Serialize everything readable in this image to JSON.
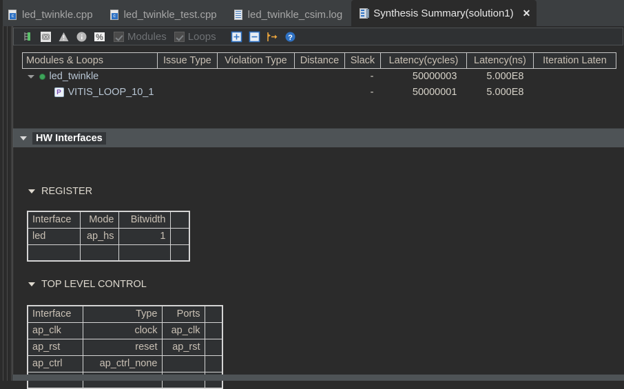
{
  "tabs": [
    {
      "label": "led_twinkle.cpp",
      "icon": "cpp-file-icon",
      "active": false,
      "closable": false
    },
    {
      "label": "led_twinkle_test.cpp",
      "icon": "cpp-file-icon",
      "active": false,
      "closable": false
    },
    {
      "label": "led_twinkle_csim.log",
      "icon": "log-file-icon",
      "active": false,
      "closable": false
    },
    {
      "label": "Synthesis Summary(solution1)",
      "icon": "report-icon",
      "active": true,
      "closable": true
    }
  ],
  "tab_close_glyph": "✕",
  "toolbar": {
    "buttons": [
      {
        "name": "tree-expand-icon",
        "title": "Expand Tree"
      },
      {
        "name": "link-icon",
        "title": "Link"
      },
      {
        "name": "warning-icon",
        "title": "Warnings"
      },
      {
        "name": "info-icon",
        "title": "Information"
      },
      {
        "name": "percent-icon",
        "title": "Percent",
        "glyph": "%"
      },
      {
        "name": "expand-all-icon",
        "title": "Expand All",
        "glyph": "+"
      },
      {
        "name": "collapse-all-icon",
        "title": "Collapse All",
        "glyph": "−"
      },
      {
        "name": "goto-icon",
        "title": "Go To"
      },
      {
        "name": "help-icon",
        "title": "Help",
        "glyph": "?"
      }
    ],
    "checkboxes": [
      {
        "label": "Modules",
        "checked": true,
        "enabled": false
      },
      {
        "label": "Loops",
        "checked": true,
        "enabled": false
      }
    ]
  },
  "main_table": {
    "columns": [
      "Modules & Loops",
      "Issue Type",
      "Violation Type",
      "Distance",
      "Slack",
      "Latency(cycles)",
      "Latency(ns)",
      "Iteration Laten"
    ],
    "rows": [
      {
        "name": "led_twinkle",
        "icon": "module-status-icon",
        "indent": 0,
        "expander": "collapse-triangle",
        "issue_type": "",
        "violation_type": "",
        "distance": "",
        "slack": "-",
        "latency_cycles": "50000003",
        "latency_ns": "5.000E8",
        "iteration_latency": ""
      },
      {
        "name": "VITIS_LOOP_10_1",
        "icon": "pipeline-loop-icon",
        "indent": 1,
        "expander": "",
        "issue_type": "",
        "violation_type": "",
        "distance": "",
        "slack": "-",
        "latency_cycles": "50000001",
        "latency_ns": "5.000E8",
        "iteration_latency": ""
      }
    ]
  },
  "hw_interfaces": {
    "title": "HW Interfaces",
    "sections": [
      {
        "title": "REGISTER",
        "columns": [
          "Interface",
          "Mode",
          "Bitwidth",
          ""
        ],
        "align": [
          "l",
          "r",
          "r",
          "l"
        ],
        "rows": [
          [
            "led",
            "ap_hs",
            "1",
            ""
          ],
          [
            "",
            "",
            "",
            ""
          ]
        ]
      },
      {
        "title": "TOP LEVEL CONTROL",
        "columns": [
          "Interface",
          "Type",
          "Ports",
          ""
        ],
        "align": [
          "l",
          "r",
          "r",
          "l"
        ],
        "rows": [
          [
            "ap_clk",
            "clock",
            "ap_clk",
            ""
          ],
          [
            "ap_rst",
            "reset",
            "ap_rst",
            ""
          ],
          [
            "ap_ctrl",
            "ap_ctrl_none",
            "",
            ""
          ],
          [
            "",
            "",
            "",
            ""
          ]
        ]
      }
    ]
  },
  "colors": {
    "tab_bar_bg": "#3c3f41",
    "editor_bg": "#2b2b2b",
    "panel_bg": "#2f3133",
    "section_bar_bg": "#4e5356",
    "text": "#c9c0b4",
    "accent_green": "#3ea35a",
    "accent_blue": "#2f72c4",
    "accent_orange": "#e8a33d"
  }
}
